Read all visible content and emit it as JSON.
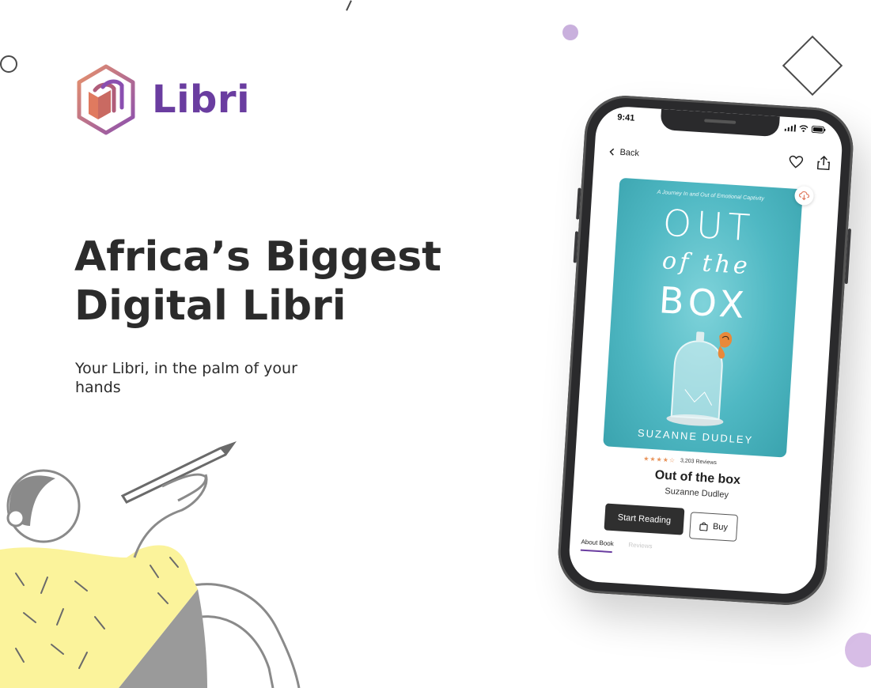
{
  "brand": {
    "name": "Libri",
    "color_primary": "#6a3da0",
    "color_accent": "#e07a5f"
  },
  "hero": {
    "headline_line1": "Africa’s Biggest",
    "headline_line2": "Digital Libri",
    "subline": "Your Libri, in the palm of your hands"
  },
  "phone": {
    "status_time": "9:41",
    "nav": {
      "back_label": "Back"
    },
    "cover": {
      "tagline": "A Journey In and Out of Emotional Captivity",
      "title_top": "OUT",
      "title_mid": "of the",
      "title_bottom": "BOX",
      "author": "SUZANNE DUDLEY",
      "background": "#4fb8c3"
    },
    "book": {
      "stars": "★★★★☆",
      "reviews": "3,203 Reviews",
      "title": "Out of the box",
      "author": "Suzanne Dudley"
    },
    "actions": {
      "start_reading": "Start Reading",
      "buy": "Buy"
    },
    "tabs": {
      "about": "About Book",
      "reviews": "Reviews"
    }
  }
}
